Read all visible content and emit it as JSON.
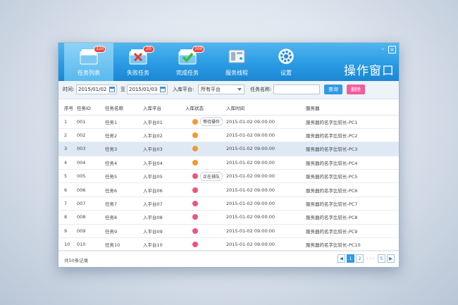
{
  "window": {
    "title": "操作窗口",
    "minimize": "–",
    "close": "×"
  },
  "nav": [
    {
      "label": "任务列表",
      "badge": "320",
      "icon": "folder-icon",
      "active": true
    },
    {
      "label": "失败任务",
      "badge": "20",
      "icon": "folder-fail-icon",
      "active": false
    },
    {
      "label": "完成任务",
      "badge": "300",
      "icon": "folder-done-icon",
      "active": false
    },
    {
      "label": "服务线程",
      "badge": "",
      "icon": "server-icon",
      "active": false
    },
    {
      "label": "设置",
      "badge": "",
      "icon": "gear-icon",
      "active": false
    }
  ],
  "filter": {
    "time_label": "时间:",
    "start_date": "2015/01/02",
    "to": "至",
    "end_date": "2015/01/03",
    "platform_label": "入库平台:",
    "platform_value": "所有平台",
    "task_name_label": "任务名称:",
    "task_name_value": "",
    "query_btn": "查询",
    "delete_btn": "删除"
  },
  "table": {
    "headers": [
      "序号",
      "任务ID",
      "任务名称",
      "入库平台",
      "入库状态",
      "入库时间",
      "服务器"
    ],
    "rows": [
      {
        "no": "1",
        "id": "001",
        "name": "任务1",
        "platform": "入平台01",
        "status": "orange",
        "tip": "等待操作",
        "time": "2015-01-02 09:00:00",
        "server": "服务器的名字比较长-PC1"
      },
      {
        "no": "2",
        "id": "002",
        "name": "任务2",
        "platform": "入平台02",
        "status": "orange",
        "tip": "",
        "time": "2015-01-02 09:00:00",
        "server": "服务器的名字比较长-PC2"
      },
      {
        "no": "3",
        "id": "003",
        "name": "任务3",
        "platform": "入平台03",
        "status": "orange",
        "tip": "",
        "time": "2015-01-02 09:00:00",
        "server": "服务器的名字比较长-PC3"
      },
      {
        "no": "4",
        "id": "004",
        "name": "任务4",
        "platform": "入平台04",
        "status": "orange",
        "tip": "",
        "time": "2015-01-02 09:00:00",
        "server": "服务器的名字比较长-PC4"
      },
      {
        "no": "5",
        "id": "005",
        "name": "任务5",
        "platform": "入平台05",
        "status": "pink",
        "tip": "正在排队",
        "time": "2015-01-02 09:00:00",
        "server": "服务器的名字比较长-PC5"
      },
      {
        "no": "6",
        "id": "006",
        "name": "任务6",
        "platform": "入平台06",
        "status": "pink",
        "tip": "",
        "time": "2015-01-02 09:00:00",
        "server": "服务器的名字比较长-PC6"
      },
      {
        "no": "7",
        "id": "007",
        "name": "任务7",
        "platform": "入平台07",
        "status": "pink",
        "tip": "",
        "time": "2015-01-02 09:00:00",
        "server": "服务器的名字比较长-PC7"
      },
      {
        "no": "8",
        "id": "008",
        "name": "任务8",
        "platform": "入平台08",
        "status": "pink",
        "tip": "",
        "time": "2015-01-02 09:00:00",
        "server": "服务器的名字比较长-PC8"
      },
      {
        "no": "9",
        "id": "009",
        "name": "任务9",
        "platform": "入平台09",
        "status": "pink",
        "tip": "",
        "time": "2015-01-02 09:00:00",
        "server": "服务器的名字比较长-PC9"
      },
      {
        "no": "10",
        "id": "010",
        "name": "任务10",
        "platform": "入平台10",
        "status": "pink",
        "tip": "",
        "time": "2015-01-02 09:00:00",
        "server": "服务器的名字比较长-PC10"
      }
    ]
  },
  "footer": {
    "count": "共50条记录",
    "pages": [
      "1",
      "2",
      "5"
    ],
    "ellipsis": "- - -"
  },
  "colors": {
    "accent": "#2f9ae6",
    "status_orange": "#f29a2e",
    "status_pink": "#e8577f",
    "delete": "#f35d9d"
  }
}
